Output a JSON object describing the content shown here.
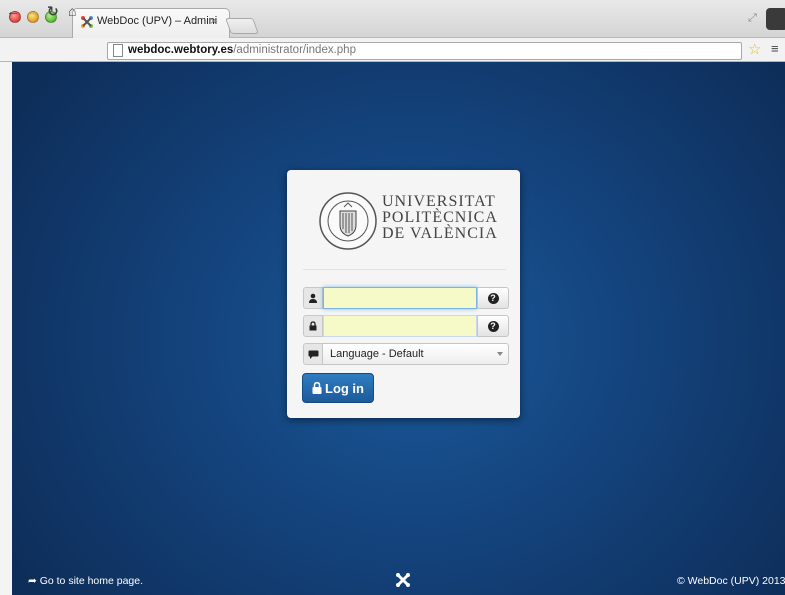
{
  "browser": {
    "tab_title": "WebDoc (UPV) – Administr",
    "tab_close": "×",
    "url_host": "webdoc.webtory.es",
    "url_path": "/administrator/index.php"
  },
  "logo": {
    "line1": "UNIVERSITAT",
    "line2": "POLITÈCNICA",
    "line3": "DE VALÈNCIA"
  },
  "form": {
    "username_value": "",
    "password_value": "",
    "help_label": "?",
    "language_selected": "Language - Default",
    "login_label": "Log in"
  },
  "footer": {
    "home_link": "Go to site home page.",
    "copyright": "© WebDoc (UPV) 2013"
  },
  "colors": {
    "page_bg": "#14447e",
    "button_blue": "#1d5a9a",
    "autofill_yellow": "#f6fac8"
  }
}
